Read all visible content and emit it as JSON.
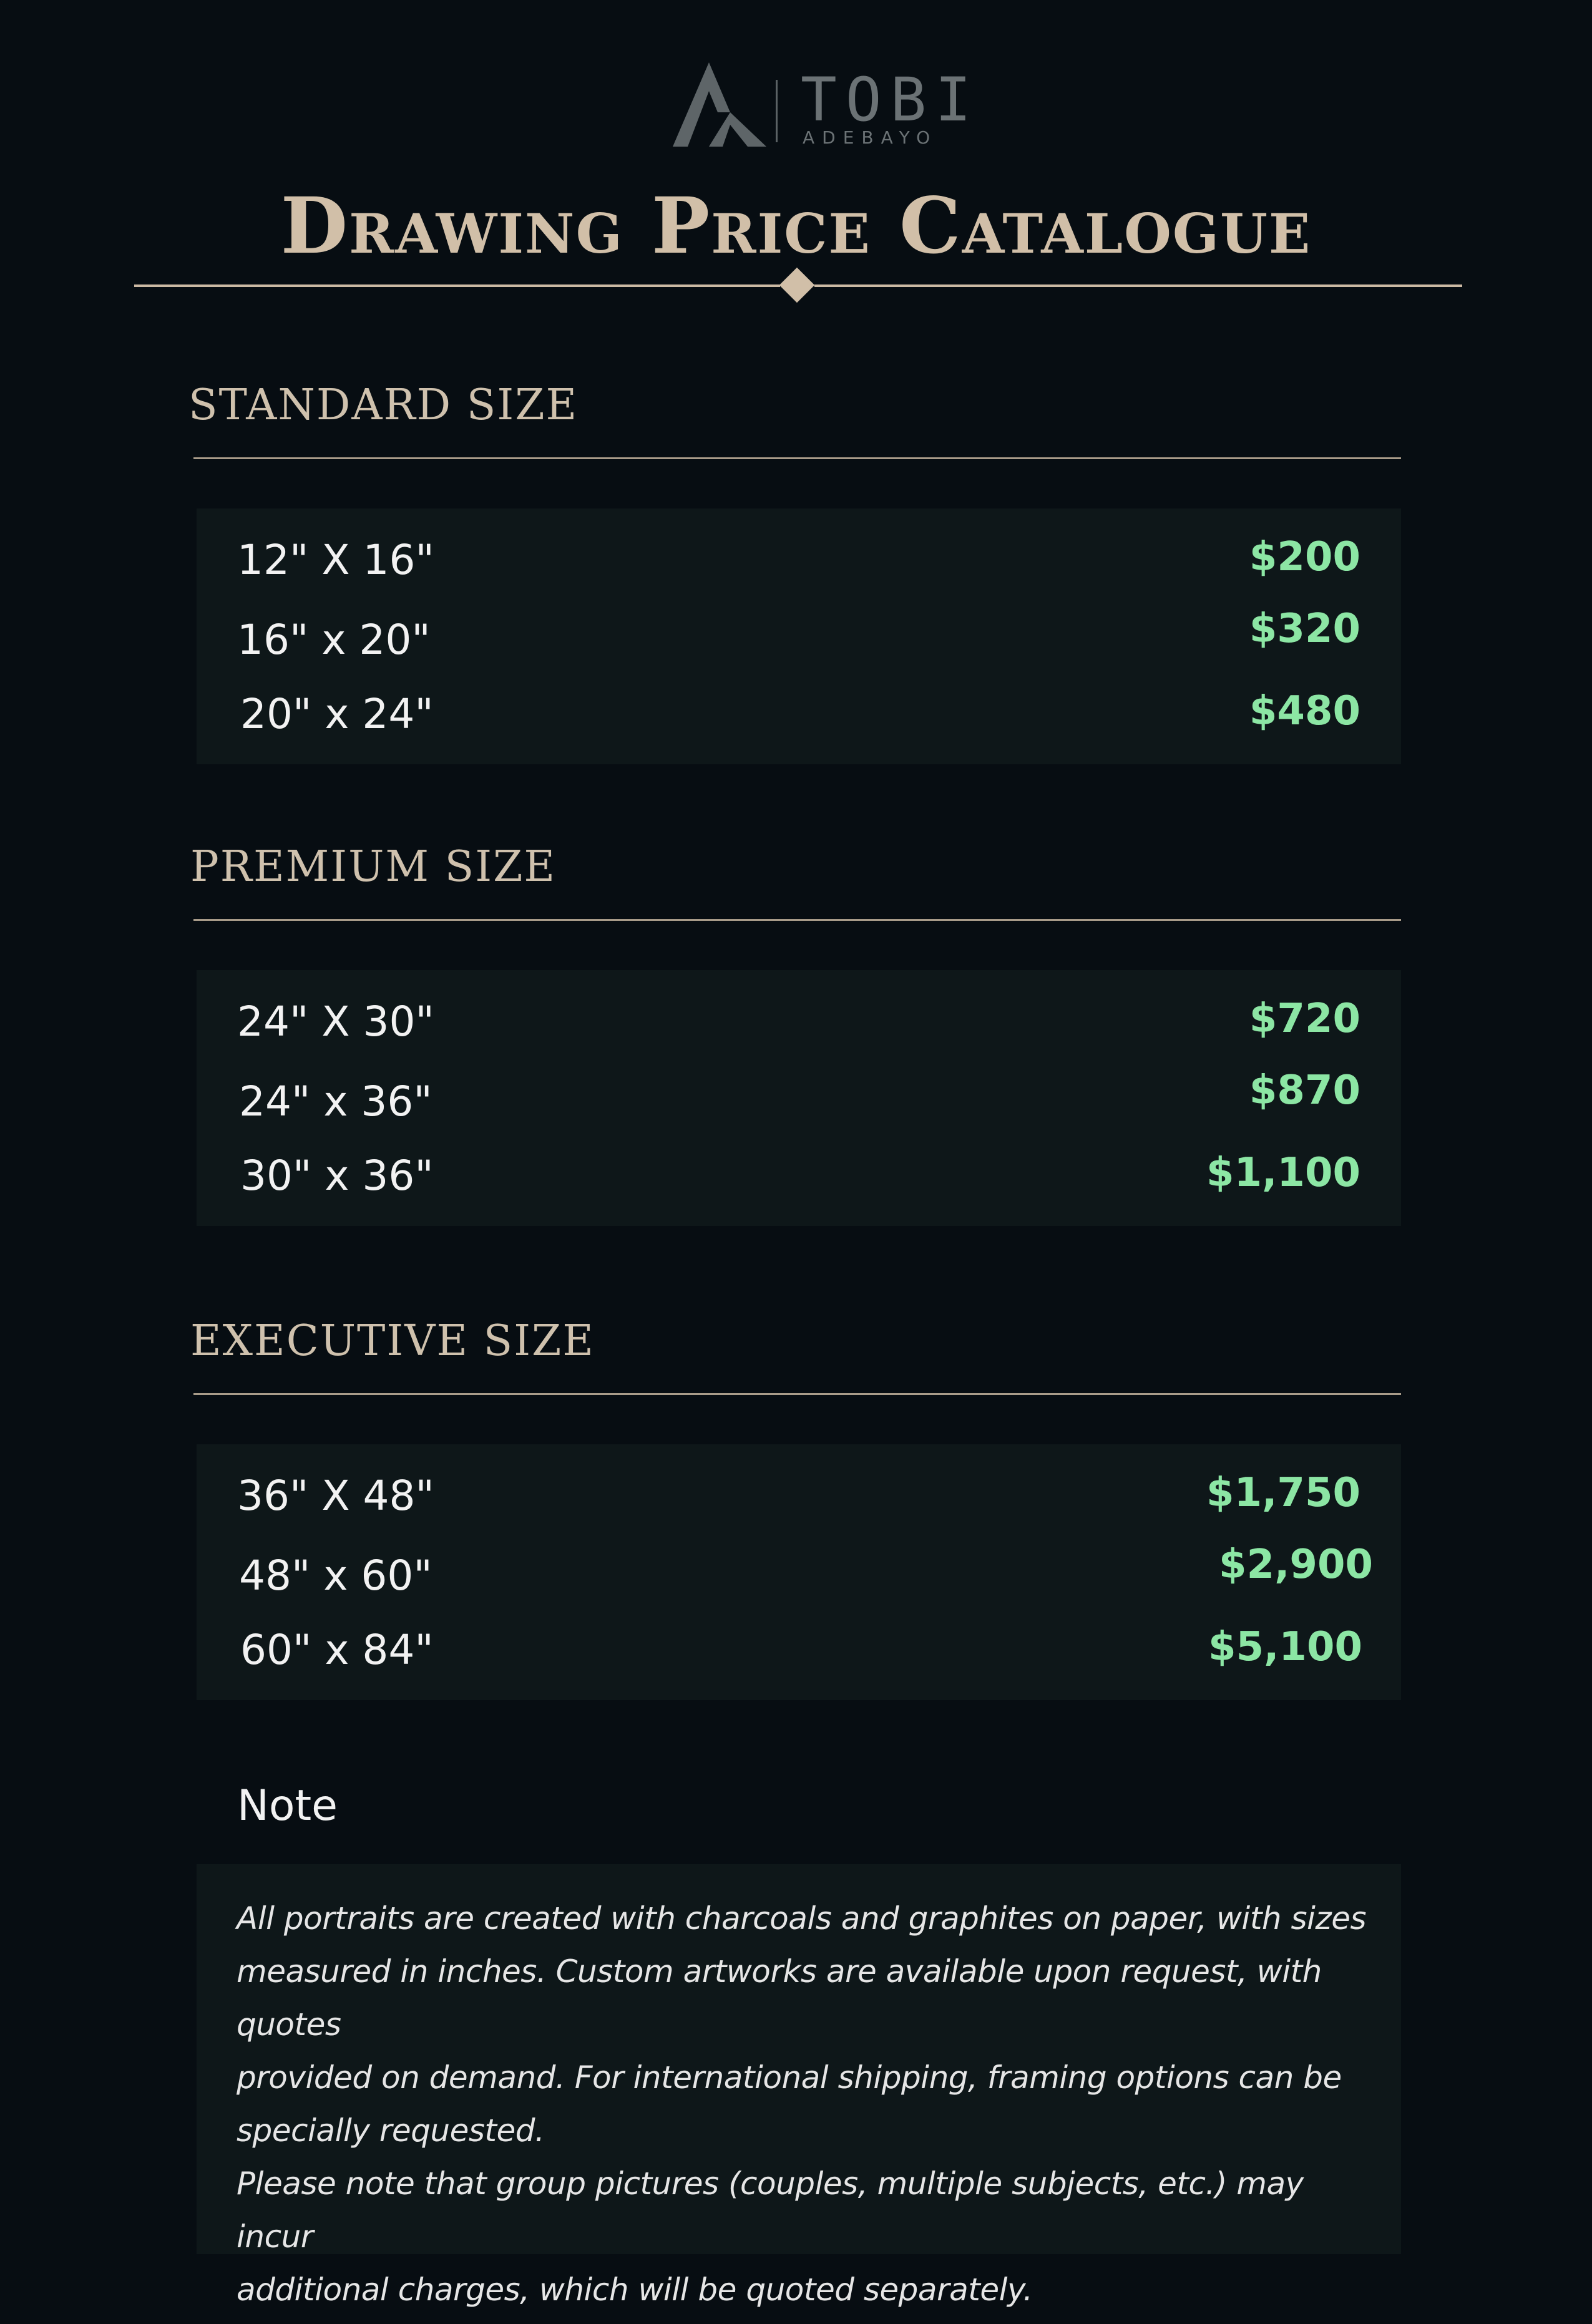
{
  "brand": {
    "name": "TOBI",
    "sub": "ADEBAYO",
    "icon": "logo-mark-icon"
  },
  "title": "Drawing Price Catalogue",
  "colors": {
    "background": "#070d12",
    "panel": "#0e1719",
    "heading": "#d1bfa8",
    "price": "#8ce6a4",
    "text": "#f2f2f2"
  },
  "sections": [
    {
      "heading": "STANDARD SIZE",
      "items": [
        {
          "size": "12\" X 16\"",
          "price": "$200"
        },
        {
          "size": "16\" x 20\"",
          "price": "$320"
        },
        {
          "size": "20\" x 24\"",
          "price": "$480"
        }
      ]
    },
    {
      "heading": "PREMIUM SIZE",
      "items": [
        {
          "size": "24\" X 30\"",
          "price": "$720"
        },
        {
          "size": "24\" x 36\"",
          "price": "$870"
        },
        {
          "size": "30\" x 36\"",
          "price": "$1,100"
        }
      ]
    },
    {
      "heading": "EXECUTIVE SIZE",
      "items": [
        {
          "size": "36\" X 48\"",
          "price": "$1,750"
        },
        {
          "size": "48\" x 60\"",
          "price": "$2,900"
        },
        {
          "size": "60\" x 84\"",
          "price": "$5,100"
        }
      ]
    }
  ],
  "note": {
    "heading": "Note",
    "body": "All  portraits  are created with charcoals and graphites on paper, with sizes\nmeasured in inches. Custom artworks are available upon request, with quotes\nprovided on demand. For international shipping, framing options can be\nspecially requested.\nPlease note that group pictures (couples, multiple subjects, etc.) may incur\nadditional charges, which will be quoted separately."
  }
}
